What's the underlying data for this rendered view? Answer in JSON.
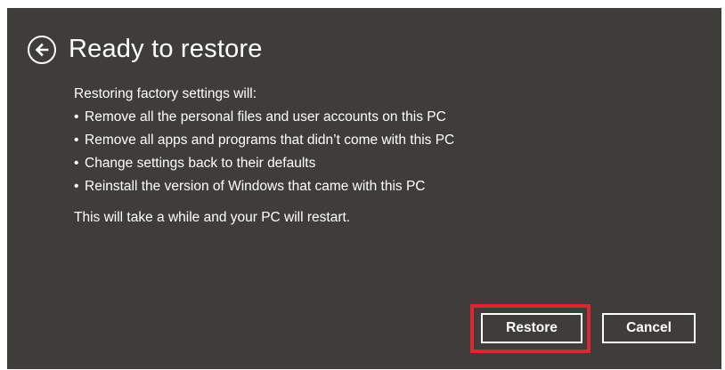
{
  "dialog": {
    "title": "Ready to restore",
    "back_icon": "arrow-left-circle-icon",
    "intro": "Restoring factory settings will:",
    "bullets": [
      "Remove all the personal files and user accounts on this PC",
      "Remove all apps and programs that didn’t come with this PC",
      "Change settings back to their defaults",
      "Reinstall the version of Windows that came with this PC"
    ],
    "note": "This will take a while and your PC will restart.",
    "restore_label": "Restore",
    "cancel_label": "Cancel"
  },
  "colors": {
    "background": "#3f3d39",
    "text": "#ffffff",
    "highlight": "#d9282f"
  }
}
